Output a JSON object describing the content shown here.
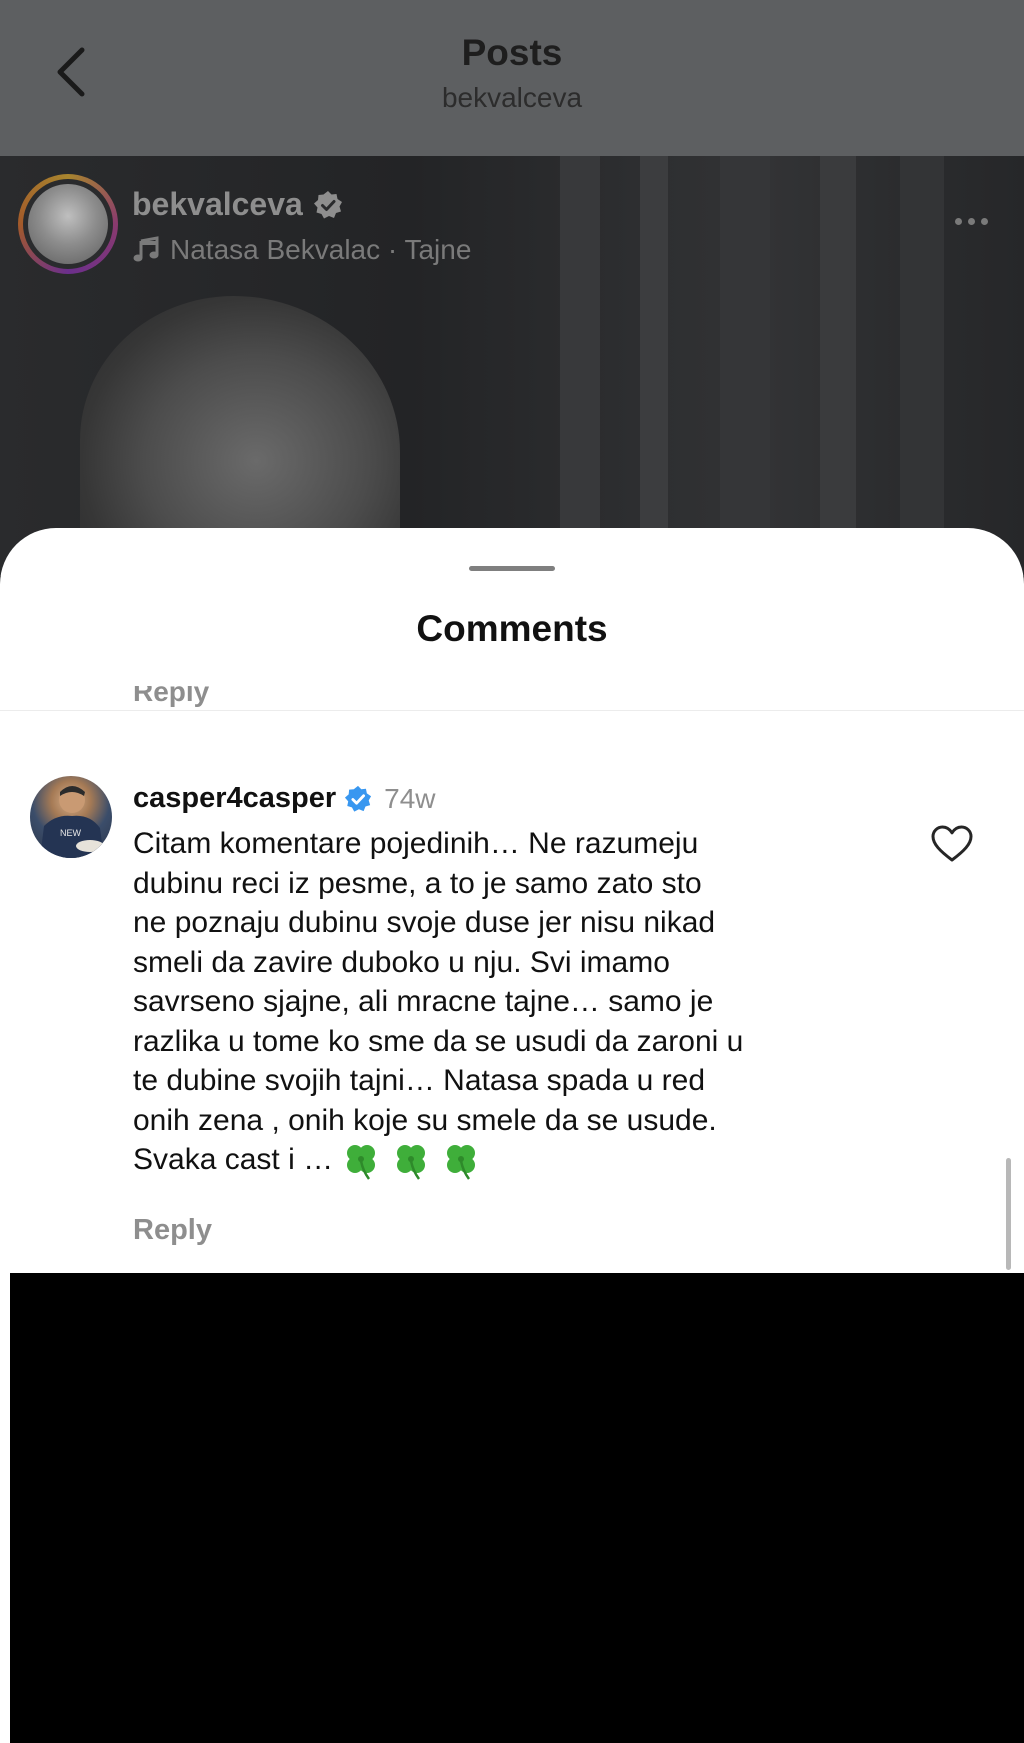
{
  "header": {
    "title": "Posts",
    "subtitle": "bekvalceva"
  },
  "post": {
    "username": "bekvalceva",
    "music": "Natasa Bekvalac · Tajne"
  },
  "comments_sheet": {
    "title": "Comments",
    "previous_reply_label": "Reply",
    "comment": {
      "username": "casper4casper",
      "time": "74w",
      "text": "Citam komentare pojedinih… Ne razumeju\ndubinu reci iz pesme, a to je samo zato sto\nne poznaju dubinu svoje duse jer nisu nikad\nsmeli da zavire duboko u nju. Svi imamo\nsavrseno sjajne, ali mracne tajne… samo je\nrazlika u tome ko sme da se usudi da zaroni u\nte dubine svojih tajni… Natasa spada u red\nonih zena , onih koje  su smele da se usude.\nSvaka cast i …",
      "reply_label": "Reply"
    }
  },
  "colors": {
    "verified_blue": "#3897f0",
    "clover_green": "#3fae3a"
  }
}
